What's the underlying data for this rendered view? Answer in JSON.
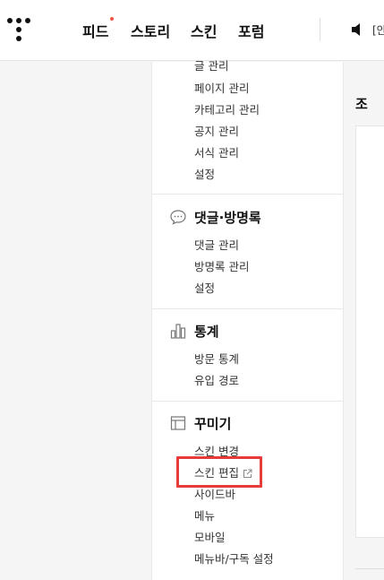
{
  "header": {
    "nav": [
      {
        "label": "피드",
        "has_new": true
      },
      {
        "label": "스토리"
      },
      {
        "label": "스킨"
      },
      {
        "label": "포럼"
      }
    ],
    "notice_prefix": "[안"
  },
  "sidebar": {
    "post_section": {
      "items": [
        "글 관리",
        "페이지 관리",
        "카테고리 관리",
        "공지 관리",
        "서식 관리",
        "설정"
      ]
    },
    "comments_section": {
      "title": "댓글·방명록",
      "icon": "speech-bubble-icon",
      "items": [
        "댓글 관리",
        "방명록 관리",
        "설정"
      ]
    },
    "stats_section": {
      "title": "통계",
      "icon": "bar-chart-icon",
      "items": [
        "방문 통계",
        "유입 경로"
      ]
    },
    "decorate_section": {
      "title": "꾸미기",
      "icon": "layout-icon",
      "items": [
        "스킨 변경",
        "스킨 편집",
        "사이드바",
        "메뉴",
        "모바일",
        "메뉴바/구독 설정"
      ]
    }
  },
  "content": {
    "heading_partial": "조"
  },
  "colors": {
    "highlight": "#e63b3b",
    "new_dot": "#ff5544"
  }
}
